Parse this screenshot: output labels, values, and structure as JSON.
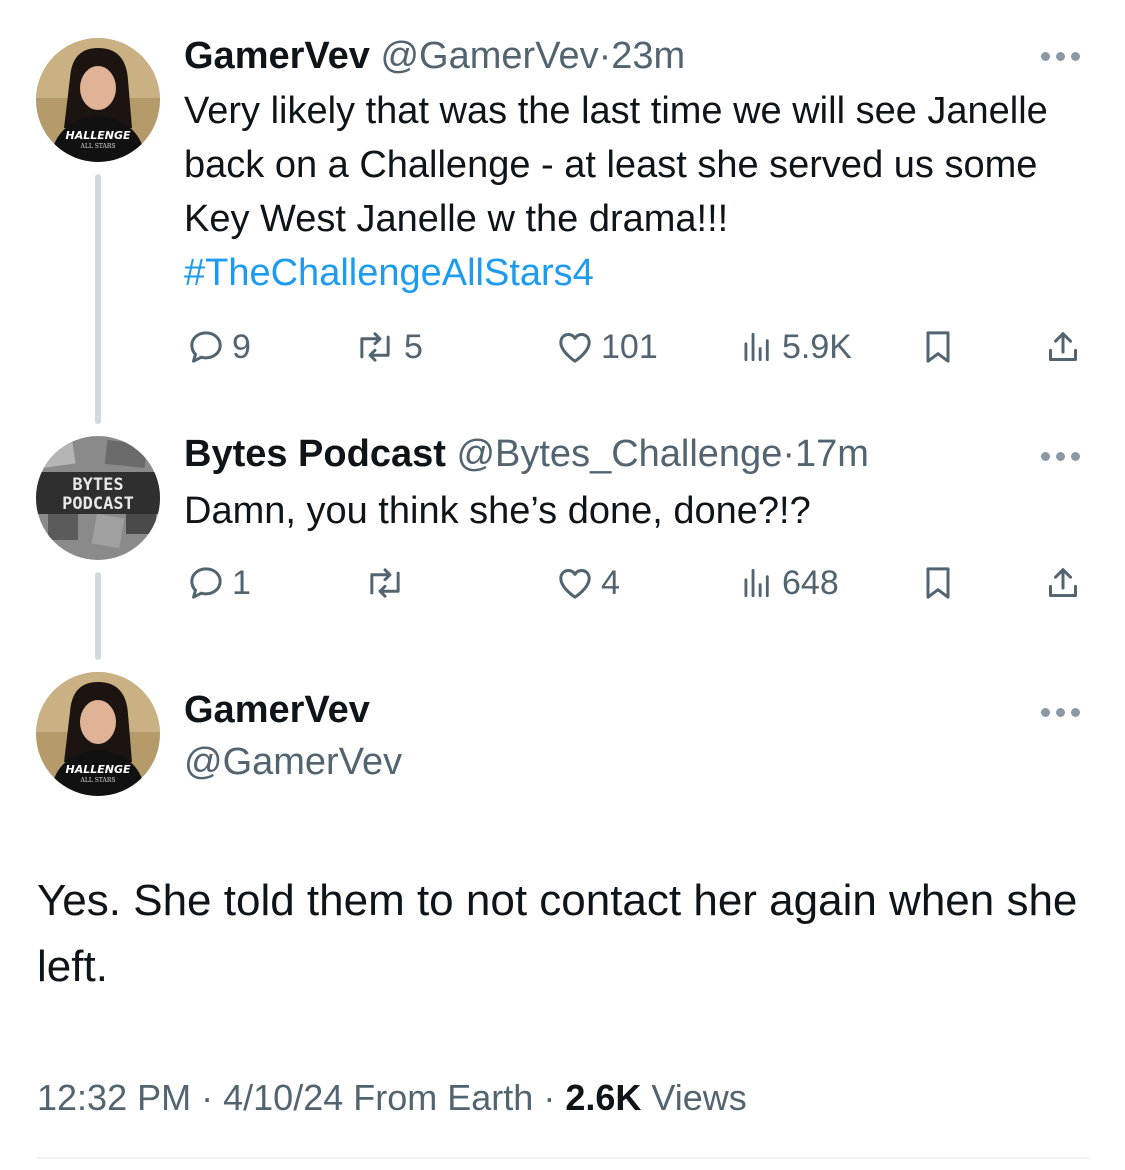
{
  "tweets": [
    {
      "name": "GamerVev",
      "handle": "@GamerVev",
      "time": "23m",
      "text": "Very likely that was the last time we will see Janelle back on a Challenge - at least she served us some Key West Janelle w the drama!!!",
      "hashtag": "#TheChallengeAllStars4",
      "replies": "9",
      "reposts": "5",
      "likes": "101",
      "views": "5.9K",
      "avatar_shirt_text": "HALLENGE",
      "avatar_shirt_subtext": "ALL STARS"
    },
    {
      "name": "Bytes Podcast",
      "handle": "@Bytes_Challenge",
      "time": "17m",
      "text": "Damn, you think she’s done, done?!?",
      "replies": "1",
      "reposts": "",
      "likes": "4",
      "views": "648",
      "avatar_text_1": "BYTES",
      "avatar_text_2": "PODCAST"
    }
  ],
  "main": {
    "name": "GamerVev",
    "handle": "@GamerVev",
    "text": "Yes. She told them to not contact her again when she left.",
    "time": "12:32 PM",
    "date": "4/10/24",
    "source": "From Earth",
    "views_count": "2.6K",
    "views_label": "Views",
    "separator": "·"
  },
  "icons": [
    "more-icon",
    "reply-icon",
    "repost-icon",
    "like-icon",
    "views-icon",
    "bookmark-icon",
    "share-icon"
  ],
  "colors": {
    "accent": "#1d9bf0",
    "secondary_text": "#536471",
    "primary_text": "#0f1419",
    "thread_line": "#cfd9de"
  }
}
